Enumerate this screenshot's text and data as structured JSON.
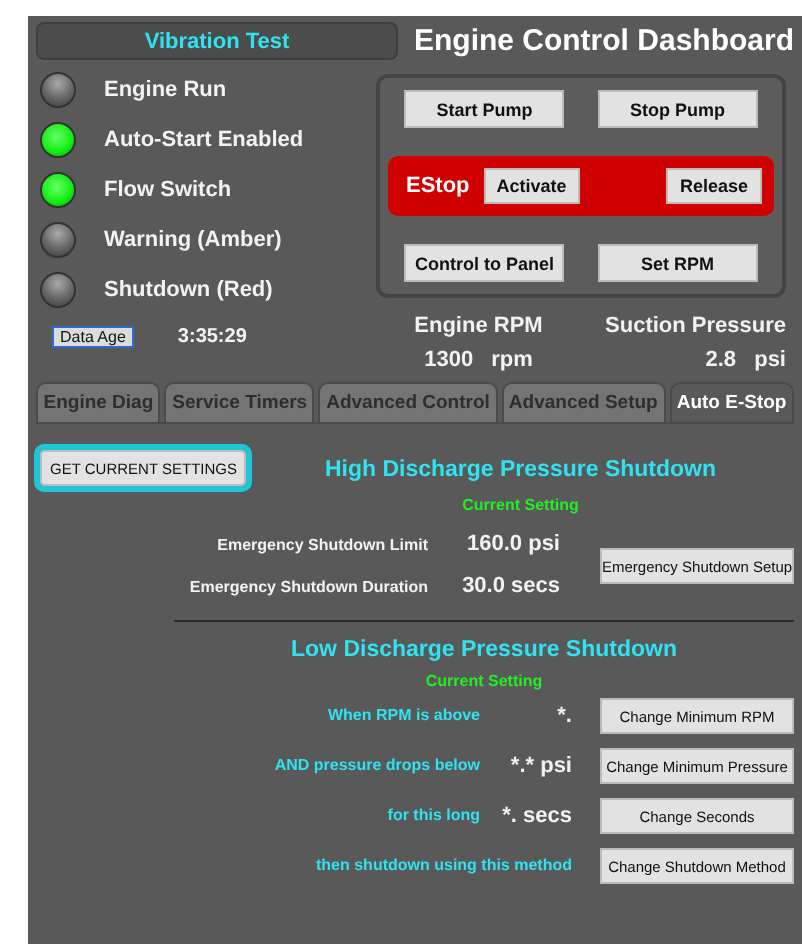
{
  "header": {
    "mode_button": "Vibration Test",
    "title": "Engine Control Dashboard"
  },
  "indicators": [
    {
      "label": "Engine Run",
      "on": false
    },
    {
      "label": "Auto-Start Enabled",
      "on": true
    },
    {
      "label": "Flow Switch",
      "on": true
    },
    {
      "label": "Warning (Amber)",
      "on": false
    },
    {
      "label": "Shutdown (Red)",
      "on": false
    }
  ],
  "data_age": {
    "button": "Data Age",
    "value": "3:35:29"
  },
  "controls": {
    "top_buttons": [
      "Start Pump",
      "Stop Pump"
    ],
    "estop": {
      "label": "EStop",
      "buttons": [
        "Activate",
        "Release"
      ]
    },
    "bottom_buttons": [
      "Control to Panel",
      "Set RPM"
    ]
  },
  "readouts": [
    {
      "label": "Engine RPM",
      "value": "1300",
      "unit": "rpm"
    },
    {
      "label": "Suction Pressure",
      "value": "2.8",
      "unit": "psi"
    }
  ],
  "tabs": [
    {
      "label": "Engine Diag",
      "selected": false
    },
    {
      "label": "Service Timers",
      "selected": false
    },
    {
      "label": "Advanced Control",
      "selected": false
    },
    {
      "label": "Advanced Setup",
      "selected": false
    },
    {
      "label": "Auto E-Stop",
      "selected": true
    }
  ],
  "get_settings": {
    "label": "GET CURRENT SETTINGS",
    "focused": true
  },
  "high_section": {
    "title": "High Discharge Pressure Shutdown",
    "subtitle": "Current Setting",
    "rows": [
      {
        "label": "Emergency Shutdown Limit",
        "value": "160.0 psi"
      },
      {
        "label": "Emergency Shutdown Duration",
        "value": "30.0 secs"
      }
    ],
    "button": "Emergency Shutdown Setup"
  },
  "low_section": {
    "title": "Low Discharge Pressure Shutdown",
    "subtitle": "Current Setting",
    "rows": [
      {
        "label": "When RPM is above",
        "value": "*.",
        "button": "Change Minimum RPM"
      },
      {
        "label": "AND pressure drops below",
        "value": "*.* psi",
        "button": "Change Minimum Pressure"
      },
      {
        "label": "for this long",
        "value": "*. secs",
        "button": "Change Seconds"
      },
      {
        "label": "then shutdown using this method",
        "button": "Change Shutdown Method"
      }
    ]
  }
}
